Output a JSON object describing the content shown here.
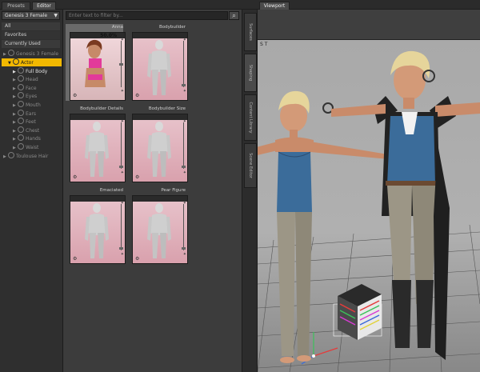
{
  "tabs": [
    {
      "label": "Presets",
      "active": false
    },
    {
      "label": "Editor",
      "active": true
    },
    {
      "label": "Viewport",
      "active": true
    }
  ],
  "left_panel": {
    "figure_selector": "Genesis 3 Female",
    "nav": [
      "All",
      "Favorites",
      "Currently Used"
    ],
    "tree": [
      {
        "label": "Genesis 3 Female",
        "level": 0,
        "state": "dim"
      },
      {
        "label": "Actor",
        "level": 1,
        "state": "selected"
      },
      {
        "label": "Full Body",
        "level": 2,
        "state": "bright"
      },
      {
        "label": "Head",
        "level": 2,
        "state": "dim"
      },
      {
        "label": "Face",
        "level": 2,
        "state": "dim"
      },
      {
        "label": "Eyes",
        "level": 2,
        "state": "dim"
      },
      {
        "label": "Mouth",
        "level": 2,
        "state": "dim"
      },
      {
        "label": "Ears",
        "level": 2,
        "state": "dim"
      },
      {
        "label": "Feet",
        "level": 2,
        "state": "dim"
      },
      {
        "label": "Chest",
        "level": 2,
        "state": "dim"
      },
      {
        "label": "Hands",
        "level": 2,
        "state": "dim"
      },
      {
        "label": "Waist",
        "level": 2,
        "state": "dim"
      },
      {
        "label": "Toulouse Hair",
        "level": 0,
        "state": "dim"
      }
    ]
  },
  "middle_panel": {
    "search_placeholder": "Enter text to filter by...",
    "search_icon": "magnifier-icon",
    "cards": [
      {
        "title": "Anna",
        "value": "50.0%",
        "selected": true
      },
      {
        "title": "Bodybuilder",
        "value": "",
        "selected": false
      },
      {
        "title": "Bodybuilder Details",
        "value": "",
        "selected": false
      },
      {
        "title": "Bodybuilder Size",
        "value": "",
        "selected": false
      },
      {
        "title": "Emaciated",
        "value": "",
        "selected": false
      },
      {
        "title": "Pear Figure",
        "value": "",
        "selected": false
      }
    ]
  },
  "side_tabs": [
    "Surfaces",
    "Shaping",
    "Content Library",
    "Scene Editor"
  ],
  "viewport": {
    "title": "Viewport",
    "corner_label": "S  T"
  },
  "colors": {
    "selection": "#f2b800",
    "panel": "#3c3c3c",
    "viewport_bg": "#a9a9a9",
    "corset": "#3b6c9a",
    "pants": "#9c9686",
    "skin": "#d39a78",
    "hair": "#e6d59b"
  }
}
